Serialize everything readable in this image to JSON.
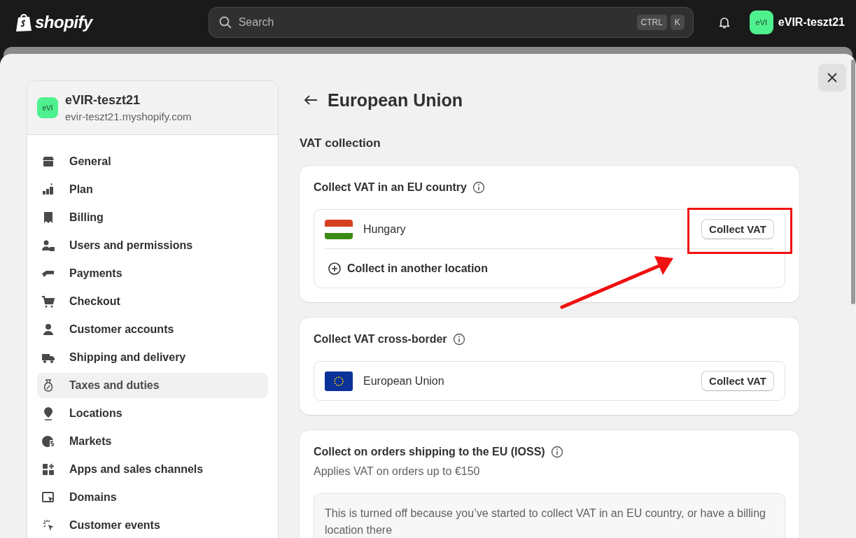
{
  "topbar": {
    "logo": "shopify",
    "search": {
      "placeholder": "Search",
      "keys": [
        "CTRL",
        "K"
      ]
    },
    "store": {
      "avatar": "eVI",
      "name": "eVIR-teszt21"
    }
  },
  "sidebar": {
    "store": {
      "avatar": "eVI",
      "name": "eVIR-teszt21",
      "domain": "evir-teszt21.myshopify.com"
    },
    "items": [
      {
        "label": "General",
        "selected": false
      },
      {
        "label": "Plan",
        "selected": false
      },
      {
        "label": "Billing",
        "selected": false
      },
      {
        "label": "Users and permissions",
        "selected": false
      },
      {
        "label": "Payments",
        "selected": false
      },
      {
        "label": "Checkout",
        "selected": false
      },
      {
        "label": "Customer accounts",
        "selected": false
      },
      {
        "label": "Shipping and delivery",
        "selected": false
      },
      {
        "label": "Taxes and duties",
        "selected": true
      },
      {
        "label": "Locations",
        "selected": false
      },
      {
        "label": "Markets",
        "selected": false
      },
      {
        "label": "Apps and sales channels",
        "selected": false
      },
      {
        "label": "Domains",
        "selected": false
      },
      {
        "label": "Customer events",
        "selected": false
      }
    ]
  },
  "page": {
    "title": "European Union",
    "section": "VAT collection",
    "cards": [
      {
        "title": "Collect VAT in an EU country",
        "rows": [
          {
            "kind": "hungary",
            "name": "Hungary",
            "button": "Collect VAT"
          },
          {
            "kind": "add",
            "label": "Collect in another location"
          }
        ]
      },
      {
        "title": "Collect VAT cross-border",
        "rows": [
          {
            "kind": "eu",
            "name": "European Union",
            "button": "Collect VAT"
          }
        ]
      },
      {
        "title": "Collect on orders shipping to the EU (IOSS)",
        "subtitle": "Applies VAT on orders up to €150",
        "notice": "This is turned off because you’ve started to collect VAT in an EU country, or have a billing location there"
      }
    ]
  }
}
